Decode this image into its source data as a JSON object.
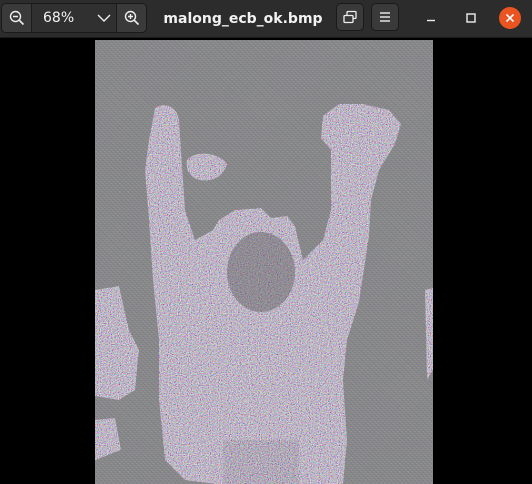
{
  "window": {
    "title": "malong_ecb_ok.bmp"
  },
  "toolbar": {
    "zoom_out_icon": "zoom-out-icon",
    "zoom_value": "68%",
    "zoom_dropdown_icon": "chevron-down-icon",
    "zoom_in_icon": "zoom-in-icon",
    "gallery_icon": "gallery-icon",
    "menu_icon": "hamburger-menu-icon"
  },
  "window_controls": {
    "minimize_icon": "minimize-icon",
    "maximize_icon": "maximize-icon",
    "close_icon": "close-icon"
  },
  "colors": {
    "headerbar": "#2c2c2c",
    "close_button": "#e95420",
    "viewer_background": "#000000"
  }
}
